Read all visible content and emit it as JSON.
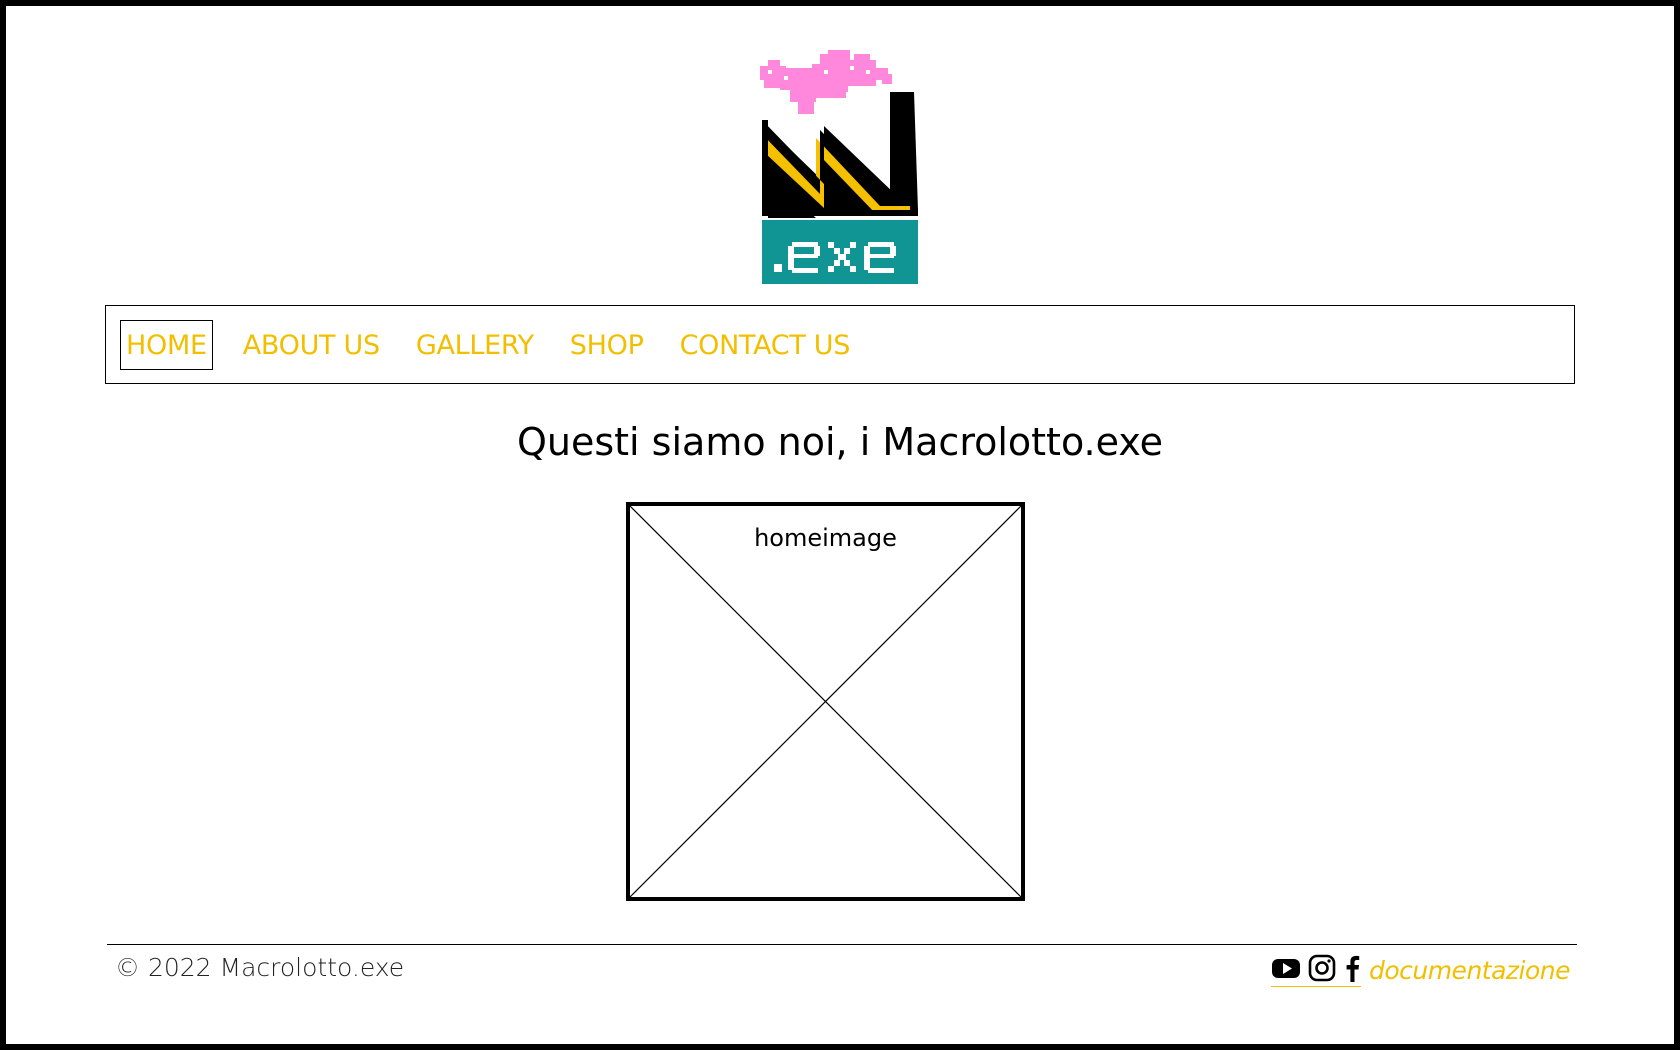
{
  "site": {
    "logo_alt": ".exe",
    "logo_text": ".exe"
  },
  "nav": {
    "items": [
      {
        "label": "HOME",
        "active": true
      },
      {
        "label": "ABOUT US",
        "active": false
      },
      {
        "label": "GALLERY",
        "active": false
      },
      {
        "label": "SHOP",
        "active": false
      },
      {
        "label": "CONTACT US",
        "active": false
      }
    ]
  },
  "main": {
    "title": "Questi siamo noi, i Macrolotto.exe",
    "image_placeholder_label": "homeimage"
  },
  "footer": {
    "copyright": "© 2022 Macrolotto.exe",
    "social_icons": [
      "youtube-icon",
      "instagram-icon",
      "facebook-icon"
    ],
    "doc_link": "documentazione"
  },
  "colors": {
    "accent": "#f1bf00",
    "logo_pink": "#ff88dd",
    "logo_yellow": "#f5c000",
    "logo_teal": "#119494",
    "border": "#000000"
  }
}
